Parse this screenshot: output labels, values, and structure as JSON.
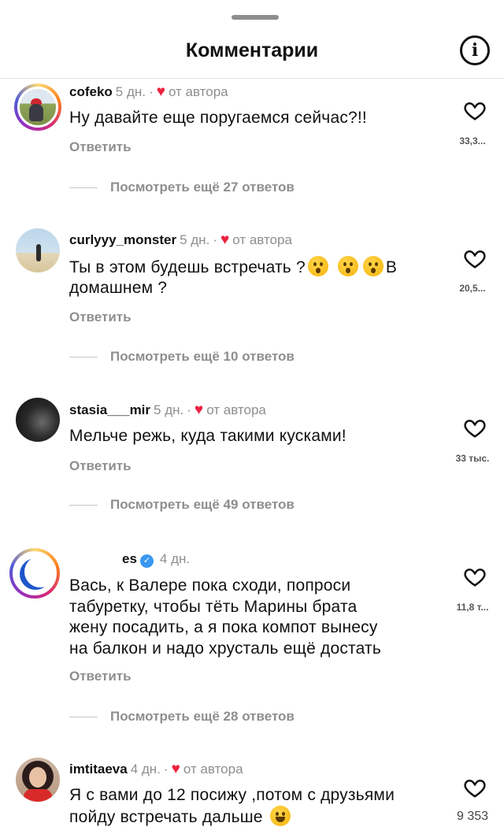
{
  "header": {
    "title": "Комментарии",
    "info_glyph": "i"
  },
  "comments": [
    {
      "username": "cofeko",
      "time": "5 дн.",
      "by_author": "от автора",
      "text": "Ну давайте еще поругаемся сейчас?!!",
      "reply": "Ответить",
      "more": "Посмотреть ещё 27 ответов",
      "likes": "33,3..."
    },
    {
      "username": "curlyyy_monster",
      "time": "5 дн.",
      "by_author": "от автора",
      "text_a": "Ты в этом будешь встречать ?",
      "text_b": "В",
      "text_c": "домашнем ?",
      "reply": "Ответить",
      "more": "Посмотреть ещё 10 ответов",
      "likes": "20,5..."
    },
    {
      "username": "stasia___mir",
      "time": "5 дн.",
      "by_author": "от автора",
      "text": "Мельче режь, куда такими кусками!",
      "reply": "Ответить",
      "more": "Посмотреть ещё 49 ответов",
      "likes": "33 тыс."
    },
    {
      "username": "es",
      "time": "4 дн.",
      "text_lines": [
        "Вась, к Валере пока сходи, попроси",
        "табуретку, чтобы тёть Марины брата",
        "жену посадить, а я пока компот вынесу",
        "на балкон и надо хрусталь ещё достать"
      ],
      "reply": "Ответить",
      "more": "Посмотреть ещё 28 ответов",
      "likes": "11,8 т..."
    },
    {
      "username": "imtitaeva",
      "time": "4 дн.",
      "by_author": "от автора",
      "text_a": "Я с вами до 12 посижу ,потом с друзьями",
      "text_b": "пойду встречать дальше",
      "likes": "9 353"
    }
  ],
  "colors": {
    "accent_red": "#ed2140",
    "muted_text": "#8e8e8e",
    "verified_blue": "#3897f0"
  },
  "icons": {
    "like": "heart-outline-icon",
    "author_like": "heart-filled-icon",
    "info": "info-circle-icon",
    "verified": "verified-badge-icon"
  }
}
